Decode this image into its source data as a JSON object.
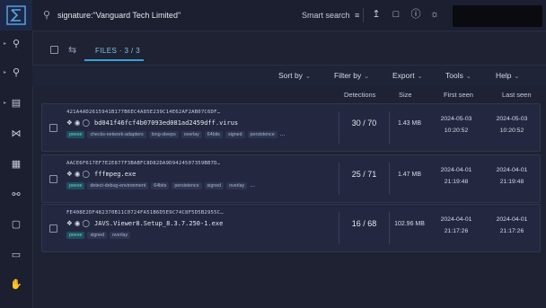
{
  "search": {
    "value": "signature:\"Vanguard Tech Limited\"",
    "placeholder": ""
  },
  "topbar": {
    "smart_search_label": "Smart search",
    "icons": [
      "search-icon",
      "filter-sliders-icon",
      "upload-icon",
      "notification-icon",
      "help-icon",
      "theme-toggle-icon"
    ]
  },
  "sidebar": {
    "icons": [
      "file-search-icon",
      "url-search-icon",
      "file-report-icon",
      "graph-icon",
      "network-icon",
      "key-icon",
      "monitor-icon",
      "id-card-icon",
      "hand-icon"
    ]
  },
  "files": {
    "tab_label": "FILES · 3 / 3"
  },
  "toolbar": {
    "sort_by": "Sort by",
    "filter_by": "Filter by",
    "export": "Export",
    "tools": "Tools",
    "help": "Help"
  },
  "columns": {
    "detections": "Detections",
    "size": "Size",
    "first_seen": "First seen",
    "last_seen": "Last seen"
  },
  "rows": [
    {
      "hash": "421A4AD2615941B177B6EC4A85E239C14E62AF2AB07C6DF…",
      "filename": "bd041f46fcf4b07093ed081ad2459dff.virus",
      "tags": [
        "peexe",
        "checks-network-adapters",
        "long-sleeps",
        "overlay",
        "64bits",
        "signed",
        "persistence"
      ],
      "more": "...",
      "detections": "30 / 70",
      "size": "1.43 MB",
      "first_seen_date": "2024-05-03",
      "first_seen_time": "10:20:52",
      "last_seen_date": "2024-05-03",
      "last_seen_time": "10:20:52"
    },
    {
      "hash": "AACE6F617EF7E2E877F3BABFC8D82DA9D9424507359BB7D…",
      "filename": "fffmpeg.exe",
      "tags": [
        "peexe",
        "detect-debug-environment",
        "64bits",
        "persistence",
        "signed",
        "overlay"
      ],
      "more": "...",
      "detections": "25 / 71",
      "size": "1.47 MB",
      "first_seen_date": "2024-04-01",
      "first_seen_time": "21:19:48",
      "last_seen_date": "2024-04-01",
      "last_seen_time": "21:19:48"
    },
    {
      "hash": "FE408E2DF482370B11C0724FA51B6D5E9C74C8F5D5B2955C…",
      "filename": "JAVS.Viewer8.Setup_8.3.7.250-1.exe",
      "tags": [
        "peexe",
        "signed",
        "overlay"
      ],
      "more": "",
      "detections": "16 / 68",
      "size": "102.96 MB",
      "first_seen_date": "2024-04-01",
      "first_seen_time": "21:17:26",
      "last_seen_date": "2024-04-01",
      "last_seen_time": "21:17:26"
    }
  ],
  "colors": {
    "accent": "#3aa0d8",
    "peexe_tag": "#6fd0d8",
    "background": "#1e2233"
  }
}
